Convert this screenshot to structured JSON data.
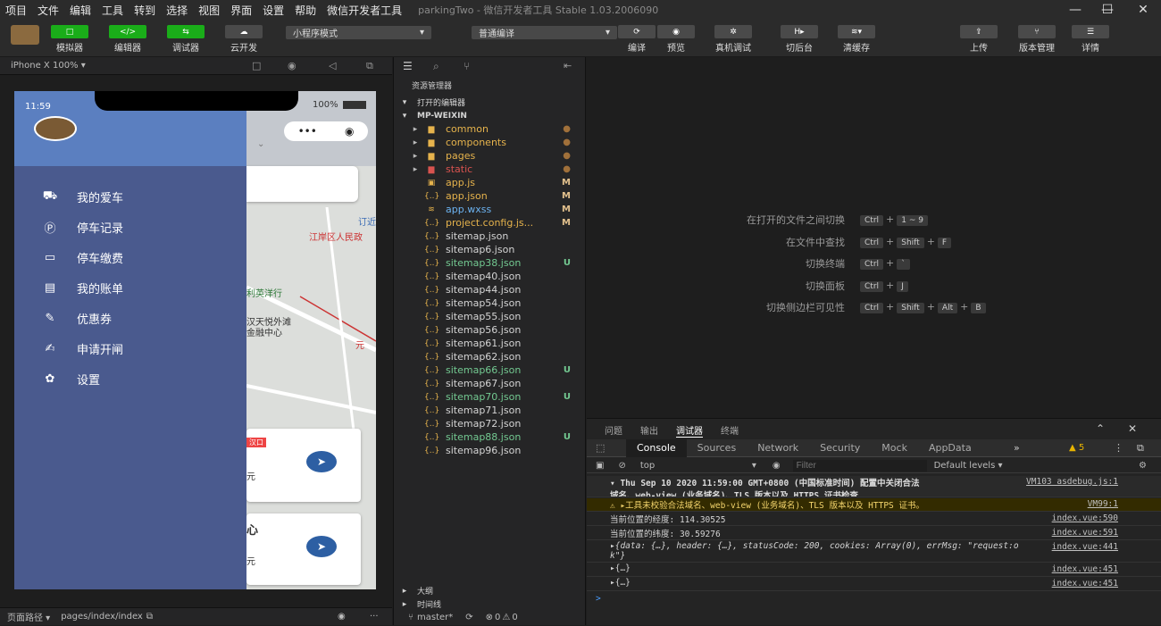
{
  "menu": [
    "项目",
    "文件",
    "编辑",
    "工具",
    "转到",
    "选择",
    "视图",
    "界面",
    "设置",
    "帮助",
    "微信开发者工具"
  ],
  "window_title": "parkingTwo - 微信开发者工具 Stable 1.03.2006090",
  "toolbar": {
    "simulator": "模拟器",
    "editor": "编辑器",
    "debugger": "调试器",
    "cloud": "云开发",
    "mode": "小程序模式",
    "compile_mode": "普通编译",
    "compile": "编译",
    "preview": "预览",
    "real_debug": "真机调试",
    "background": "切后台",
    "clear_cache": "清缓存",
    "upload": "上传",
    "version": "版本管理",
    "details": "详情"
  },
  "sim": {
    "device": "iPhone X 100% ▾",
    "time": "11:59",
    "battery": "100%",
    "drawer_items": [
      "我的爱车",
      "停车记录",
      "停车缴费",
      "我的账单",
      "优惠券",
      "申请开闸",
      "设置"
    ],
    "drawer_icons": [
      "car-icon",
      "parking-icon",
      "payment-icon",
      "bill-icon",
      "coupon-icon",
      "gate-icon",
      "gear-icon"
    ],
    "map_labels": [
      "江岸区人民政",
      "利英洋行",
      "汉天悦外滩",
      "金融中心",
      "江岸",
      "汉口",
      "订近",
      "元",
      "心",
      "元"
    ]
  },
  "statusbar": {
    "path_label": "页面路径 ▾",
    "path": "pages/index/index"
  },
  "explorer": {
    "title": "资源管理器",
    "open_editors": "打开的编辑器",
    "project": "MP-WEIXIN",
    "files": [
      {
        "name": "common",
        "type": "folder",
        "color": "#e6b34c",
        "status": "dot"
      },
      {
        "name": "components",
        "type": "folder",
        "color": "#e6b34c",
        "status": "dot"
      },
      {
        "name": "pages",
        "type": "folder",
        "color": "#e6b34c",
        "status": "dot"
      },
      {
        "name": "static",
        "type": "folder",
        "color": "#d9534f",
        "status": "dot"
      },
      {
        "name": "app.js",
        "type": "js",
        "color": "#e6b34c",
        "status": "M"
      },
      {
        "name": "app.json",
        "type": "json",
        "color": "#e6b34c",
        "status": "M"
      },
      {
        "name": "app.wxss",
        "type": "css",
        "color": "#6bb2f0",
        "status": "M"
      },
      {
        "name": "project.config.js...",
        "type": "json",
        "color": "#e6b34c",
        "status": "M"
      },
      {
        "name": "sitemap.json",
        "type": "json",
        "color": "#d4d4d4",
        "status": ""
      },
      {
        "name": "sitemap6.json",
        "type": "json",
        "color": "#d4d4d4",
        "status": ""
      },
      {
        "name": "sitemap38.json",
        "type": "json",
        "color": "#73c991",
        "status": "U"
      },
      {
        "name": "sitemap40.json",
        "type": "json",
        "color": "#d4d4d4",
        "status": ""
      },
      {
        "name": "sitemap44.json",
        "type": "json",
        "color": "#d4d4d4",
        "status": ""
      },
      {
        "name": "sitemap54.json",
        "type": "json",
        "color": "#d4d4d4",
        "status": ""
      },
      {
        "name": "sitemap55.json",
        "type": "json",
        "color": "#d4d4d4",
        "status": ""
      },
      {
        "name": "sitemap56.json",
        "type": "json",
        "color": "#d4d4d4",
        "status": ""
      },
      {
        "name": "sitemap61.json",
        "type": "json",
        "color": "#d4d4d4",
        "status": ""
      },
      {
        "name": "sitemap62.json",
        "type": "json",
        "color": "#d4d4d4",
        "status": ""
      },
      {
        "name": "sitemap66.json",
        "type": "json",
        "color": "#73c991",
        "status": "U"
      },
      {
        "name": "sitemap67.json",
        "type": "json",
        "color": "#d4d4d4",
        "status": ""
      },
      {
        "name": "sitemap70.json",
        "type": "json",
        "color": "#73c991",
        "status": "U"
      },
      {
        "name": "sitemap71.json",
        "type": "json",
        "color": "#d4d4d4",
        "status": ""
      },
      {
        "name": "sitemap72.json",
        "type": "json",
        "color": "#d4d4d4",
        "status": ""
      },
      {
        "name": "sitemap88.json",
        "type": "json",
        "color": "#73c991",
        "status": "U"
      },
      {
        "name": "sitemap96.json",
        "type": "json",
        "color": "#d4d4d4",
        "status": ""
      }
    ],
    "outline": "大纲",
    "timeline": "时间线",
    "branch": "master*",
    "errors": "0",
    "warnings": "0"
  },
  "shortcuts": [
    {
      "label": "在打开的文件之间切换",
      "keys": [
        "Ctrl",
        "1 ~ 9"
      ]
    },
    {
      "label": "在文件中查找",
      "keys": [
        "Ctrl",
        "Shift",
        "F"
      ]
    },
    {
      "label": "切换终端",
      "keys": [
        "Ctrl",
        "`"
      ]
    },
    {
      "label": "切换面板",
      "keys": [
        "Ctrl",
        "J"
      ]
    },
    {
      "label": "切换侧边栏可见性",
      "keys": [
        "Ctrl",
        "Shift",
        "Alt",
        "B"
      ]
    }
  ],
  "devtools": {
    "panel_tabs": [
      "问题",
      "输出",
      "调试器",
      "终端"
    ],
    "tabs": [
      "Console",
      "Sources",
      "Network",
      "Security",
      "Mock",
      "AppData"
    ],
    "more": "»",
    "warn_count": "5",
    "context": "top",
    "filter_placeholder": "Filter",
    "levels": "Default levels ▾",
    "logs": [
      {
        "text": "▾ Thu Sep 10 2020 11:59:00 GMT+0800 (中国标准时间) 配置中关闭合法",
        "text2": "域名、web-view (业务域名)、TLS 版本以及 HTTPS 证书检查",
        "link": "VM103 asdebug.js:1",
        "kind": "info"
      },
      {
        "text": "⚠ ▸工具未校验合法域名、web-view (业务域名)、TLS 版本以及 HTTPS 证书。",
        "link": "VM99:1",
        "kind": "warn"
      },
      {
        "text": "当前位置的经度: 114.30525",
        "link": "index.vue:590",
        "kind": "log"
      },
      {
        "text": "当前位置的纬度: 30.59276",
        "link": "index.vue:591",
        "kind": "log"
      },
      {
        "text": "▸{data: {…}, header: {…}, statusCode: 200, cookies: Array(0), errMsg: \"request:o",
        "text2": "k\"}",
        "link": "index.vue:441",
        "kind": "obj"
      },
      {
        "text": "▸{…}",
        "link": "index.vue:451",
        "kind": "log"
      },
      {
        "text": "▸{…}",
        "link": "index.vue:451",
        "kind": "log"
      }
    ]
  }
}
